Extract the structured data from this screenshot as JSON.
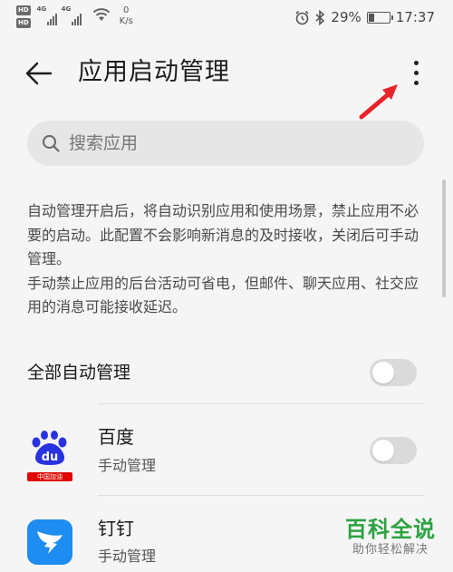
{
  "status_bar": {
    "hd1": "HD",
    "hd2": "HD",
    "net1": "4G",
    "net2": "4G",
    "speed_value": "0",
    "speed_unit": "K/s",
    "battery_percent": "29%",
    "battery_level": 0.29,
    "time": "17:37"
  },
  "header": {
    "title": "应用启动管理"
  },
  "search": {
    "placeholder": "搜索应用"
  },
  "description": {
    "paragraph1": "自动管理开启后，将自动识别应用和使用场景，禁止应用不必要的启动。此配置不会影响新消息的及时接收，关闭后可手动管理。",
    "paragraph2": "手动禁止应用的后台活动可省电，但邮件、聊天应用、社交应用的消息可能接收延迟。"
  },
  "all_auto": {
    "label": "全部自动管理",
    "enabled": false
  },
  "apps": [
    {
      "name": "百度",
      "status": "手动管理",
      "icon": "baidu-logo",
      "badge": "中国加油",
      "enabled": false
    },
    {
      "name": "钉钉",
      "status": "手动管理",
      "icon": "dingtalk-logo",
      "enabled": false
    }
  ],
  "watermark": {
    "title": "百科全说",
    "subtitle": "助你轻松解决"
  },
  "colors": {
    "background": "#f5f5f5",
    "arrow_red": "#e8232a",
    "baidu_blue": "#2932e1",
    "baidu_red": "#e10602",
    "dingtalk_blue": "#1e8cf0",
    "watermark_green": "#2ca341"
  }
}
